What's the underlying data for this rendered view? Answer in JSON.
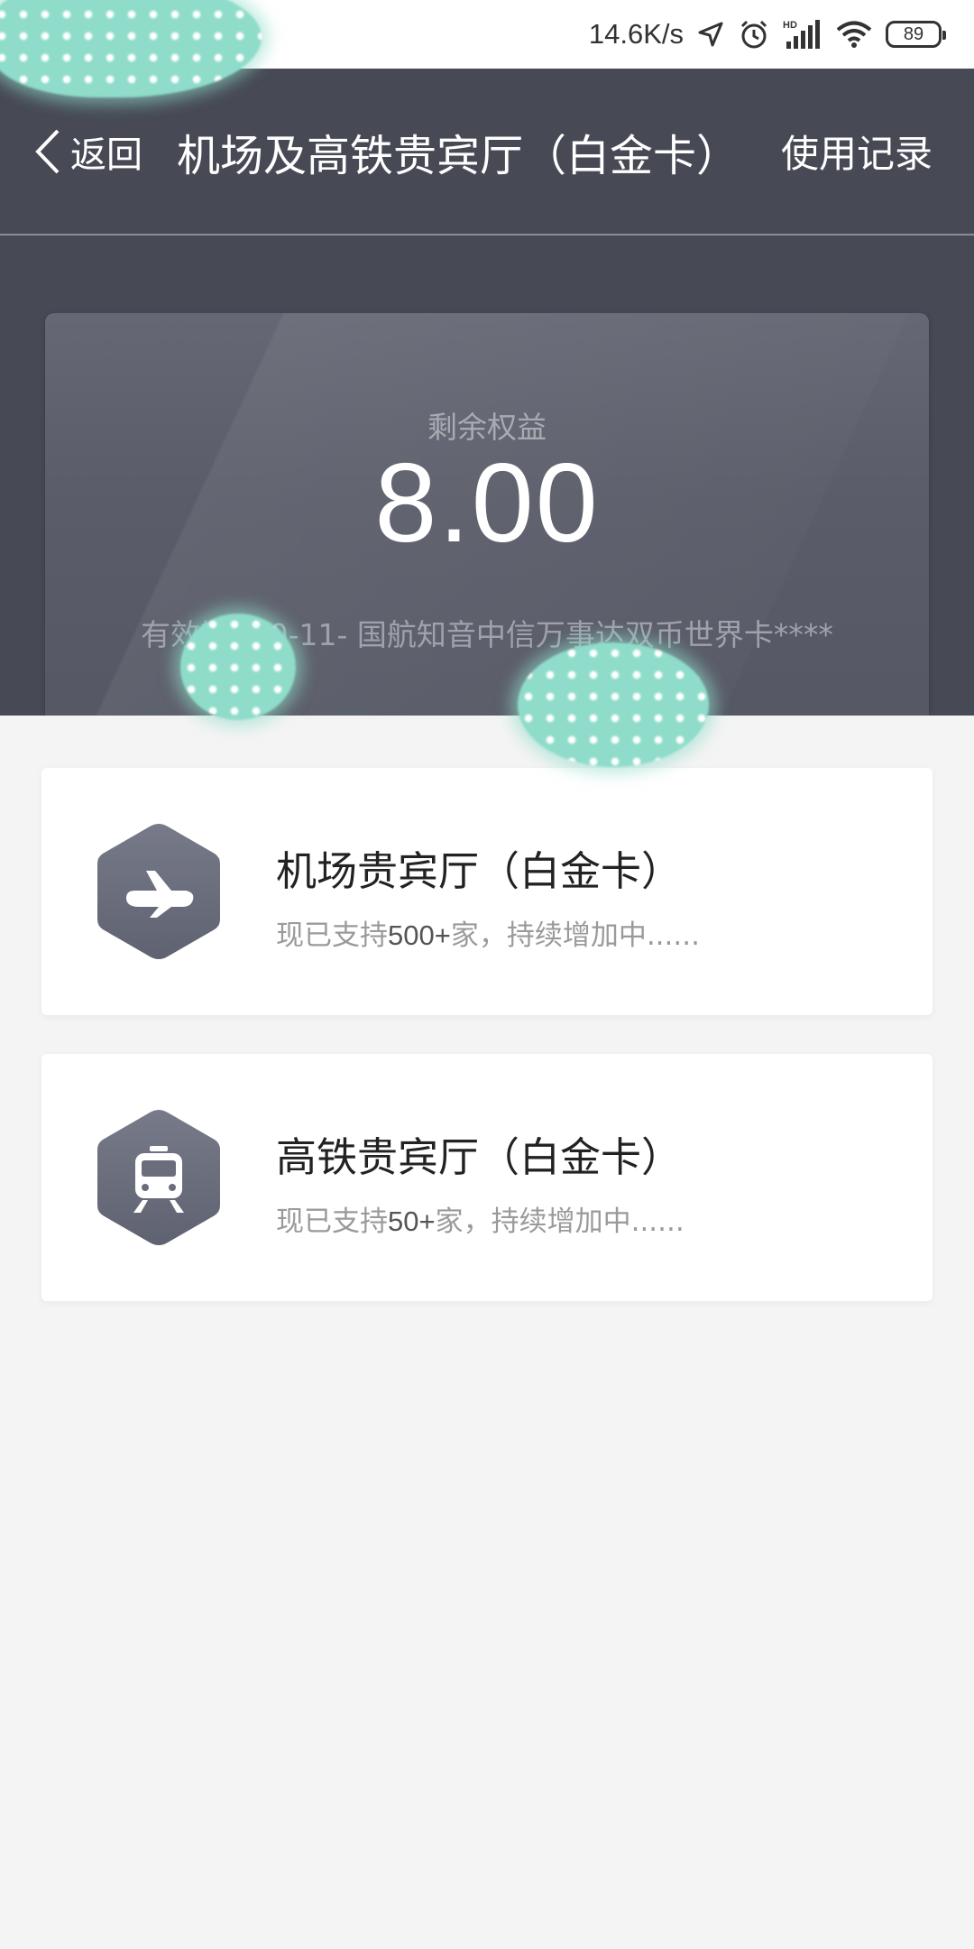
{
  "status_bar": {
    "speed": "14.6K/s",
    "battery": "89",
    "icons": [
      "location-arrow-icon",
      "alarm-icon",
      "hd-signal-icon",
      "wifi-icon",
      "battery-icon"
    ]
  },
  "header": {
    "back_label": "返回",
    "title": "机场及高铁贵宾厅（白金卡）",
    "records_label": "使用记录"
  },
  "benefit_card": {
    "label": "剩余权益",
    "value": "8.00",
    "validity_info": "有效期至 0-11-  国航知音中信万事达双币世界卡****"
  },
  "services": [
    {
      "title": "机场贵宾厅（白金卡）",
      "subtitle_prefix": "现已支持",
      "subtitle_number": "500+",
      "subtitle_suffix": "家，持续增加中......",
      "icon": "airplane-icon"
    },
    {
      "title": "高铁贵宾厅（白金卡）",
      "subtitle_prefix": "现已支持",
      "subtitle_number": "50+",
      "subtitle_suffix": "家，持续增加中......",
      "icon": "train-icon"
    }
  ],
  "colors": {
    "header_bg": "#474a55",
    "card_bg": "#5a5d69",
    "page_bg": "#f4f4f4",
    "icon_hex": "#6a6d7c",
    "overlay_dots": "#8fdcca"
  }
}
